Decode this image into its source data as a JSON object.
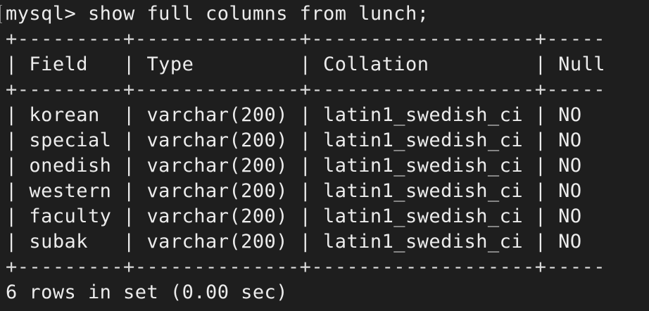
{
  "terminal": {
    "prompt_line": "mysql> show full columns from lunch;",
    "border_line": "+---------+--------------+-------------------+-----",
    "header_line": "| Field   | Type         | Collation         | Null",
    "rows": [
      "| korean  | varchar(200) | latin1_swedish_ci | NO",
      "| special | varchar(200) | latin1_swedish_ci | NO",
      "| onedish | varchar(200) | latin1_swedish_ci | NO",
      "| western | varchar(200) | latin1_swedish_ci | NO",
      "| faculty | varchar(200) | latin1_swedish_ci | NO",
      "| subak   | varchar(200) | latin1_swedish_ci | NO"
    ],
    "footer_line": "6 rows in set (0.00 sec)"
  },
  "colors": {
    "background": "#1e1e1e",
    "text": "#ececec"
  }
}
